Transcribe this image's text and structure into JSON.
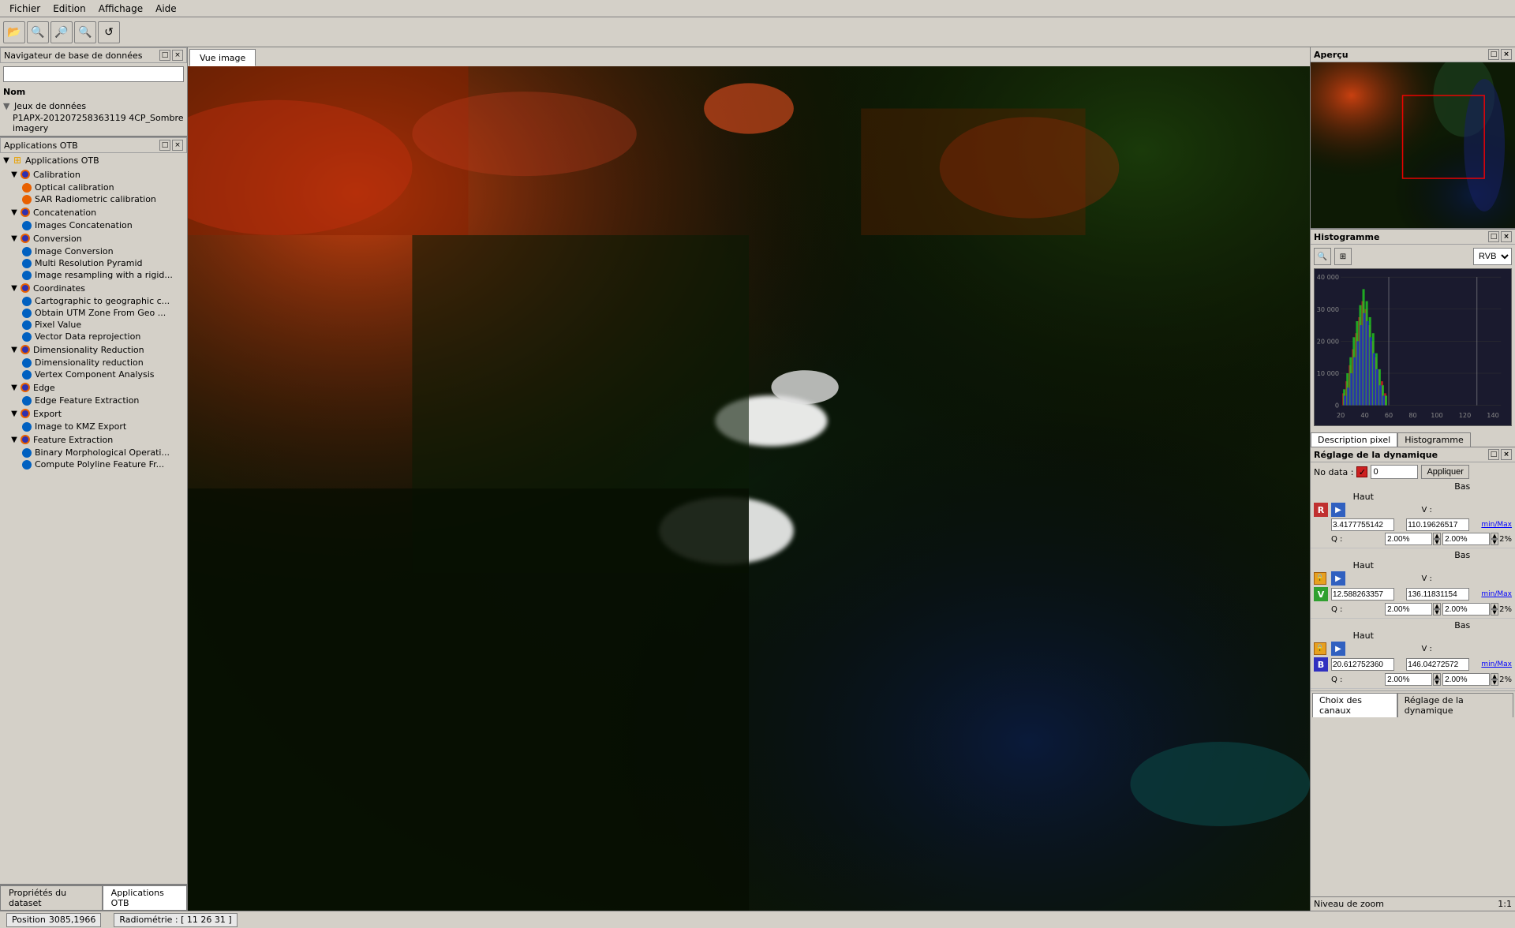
{
  "menubar": {
    "items": [
      "Fichier",
      "Edition",
      "Affichage",
      "Aide"
    ]
  },
  "toolbar": {
    "buttons": [
      "open",
      "search",
      "zoom-in",
      "zoom-out",
      "refresh"
    ]
  },
  "nav_panel": {
    "title": "Navigateur de base de données",
    "col_label": "Nom",
    "tree": {
      "root": "Jeux de données",
      "items": [
        {
          "label": "P1APX-201207258363119 4CP_Sombre imagery",
          "indent": 1
        }
      ]
    }
  },
  "otb_panel": {
    "title": "Applications OTB",
    "root": "Applications OTB",
    "groups": [
      {
        "name": "Calibration",
        "children": [
          "Optical calibration",
          "SAR Radiometric calibration"
        ]
      },
      {
        "name": "Concatenation",
        "children": [
          "Images Concatenation"
        ]
      },
      {
        "name": "Conversion",
        "children": [
          "Image Conversion",
          "Multi Resolution Pyramid",
          "Image resampling with a rigid..."
        ]
      },
      {
        "name": "Coordinates",
        "children": [
          "Cartographic to geographic c...",
          "Obtain UTM Zone From Geo ...",
          "Pixel Value",
          "Vector Data reprojection"
        ]
      },
      {
        "name": "Dimensionality Reduction",
        "children": [
          "Dimensionality reduction",
          "Vertex Component Analysis"
        ]
      },
      {
        "name": "Edge",
        "children": [
          "Edge Feature Extraction"
        ]
      },
      {
        "name": "Export",
        "children": [
          "Image to KMZ Export"
        ]
      },
      {
        "name": "Feature Extraction",
        "children": [
          "Binary Morphological Operati...",
          "Compute Polyline Feature Fr..."
        ]
      }
    ]
  },
  "tab_bar": {
    "tabs": [
      "Vue image"
    ]
  },
  "apercu": {
    "title": "Aperçu"
  },
  "histogram": {
    "title": "Histogramme",
    "mode": "RVB",
    "y_labels": [
      "40 000",
      "30 000",
      "20 000",
      "10 000",
      "0"
    ],
    "x_labels": [
      "20",
      "40",
      "60",
      "80",
      "100",
      "120",
      "140"
    ],
    "sub_tabs": [
      "Description pixel",
      "Histogramme"
    ]
  },
  "dynamic": {
    "title": "Réglage de la dynamique",
    "no_data_label": "No data :",
    "no_data_value": "0",
    "apply_label": "Appliquer",
    "channels": [
      {
        "label": "R",
        "bas_label": "Bas",
        "haut_label": "Haut",
        "v_label": "V :",
        "v_bas": "3.4177755142",
        "v_haut": "110.19626517",
        "min_max": "min/Max",
        "q_label": "Q :",
        "q_bas": "2.00%",
        "q_haut": "2.00%",
        "q_pct": "2%"
      },
      {
        "label": "V",
        "bas_label": "Bas",
        "haut_label": "Haut",
        "v_label": "V :",
        "v_bas": "12.588263357",
        "v_haut": "136.11831154",
        "min_max": "min/Max",
        "q_label": "Q :",
        "q_bas": "2.00%",
        "q_haut": "2.00%",
        "q_pct": "2%"
      },
      {
        "label": "B",
        "bas_label": "Bas",
        "haut_label": "Haut",
        "v_label": "V :",
        "v_bas": "20.612752360",
        "v_haut": "146.04272572",
        "min_max": "min/Max",
        "q_label": "Q :",
        "q_bas": "2.00%",
        "q_haut": "2.00%",
        "q_pct": "2%"
      }
    ]
  },
  "channel_select": {
    "label": "Choix des canaux"
  },
  "dynamic_tab_label": "Réglage de la dynamique",
  "zoom_label": "Niveau de zoom",
  "zoom_value": "1:1",
  "bottom_tabs": [
    "Propriétés du dataset",
    "Applications OTB"
  ],
  "statusbar": {
    "position_label": "Position",
    "position_value": "3085,1966",
    "radiometry_label": "Radiométrie : [ 11 26 31 ]"
  }
}
